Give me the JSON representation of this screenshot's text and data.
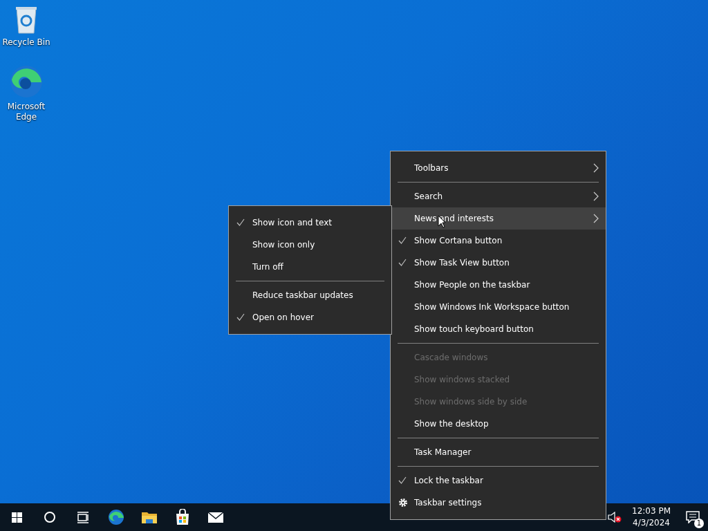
{
  "desktop_icons": [
    {
      "label": "Recycle Bin",
      "kind": "recycle"
    },
    {
      "label": "Microsoft Edge",
      "kind": "edge"
    }
  ],
  "context_menu": {
    "items": [
      {
        "kind": "item",
        "label": "Toolbars",
        "checked": false,
        "disabled": false,
        "submenu": true,
        "selected": false
      },
      {
        "kind": "separator"
      },
      {
        "kind": "item",
        "label": "Search",
        "checked": false,
        "disabled": false,
        "submenu": true,
        "selected": false
      },
      {
        "kind": "item",
        "label": "News and interests",
        "checked": false,
        "disabled": false,
        "submenu": true,
        "selected": true
      },
      {
        "kind": "item",
        "label": "Show Cortana button",
        "checked": true,
        "disabled": false,
        "submenu": false,
        "selected": false
      },
      {
        "kind": "item",
        "label": "Show Task View button",
        "checked": true,
        "disabled": false,
        "submenu": false,
        "selected": false
      },
      {
        "kind": "item",
        "label": "Show People on the taskbar",
        "checked": false,
        "disabled": false,
        "submenu": false,
        "selected": false
      },
      {
        "kind": "item",
        "label": "Show Windows Ink Workspace button",
        "checked": false,
        "disabled": false,
        "submenu": false,
        "selected": false
      },
      {
        "kind": "item",
        "label": "Show touch keyboard button",
        "checked": false,
        "disabled": false,
        "submenu": false,
        "selected": false
      },
      {
        "kind": "separator"
      },
      {
        "kind": "item",
        "label": "Cascade windows",
        "checked": false,
        "disabled": true,
        "submenu": false,
        "selected": false
      },
      {
        "kind": "item",
        "label": "Show windows stacked",
        "checked": false,
        "disabled": true,
        "submenu": false,
        "selected": false
      },
      {
        "kind": "item",
        "label": "Show windows side by side",
        "checked": false,
        "disabled": true,
        "submenu": false,
        "selected": false
      },
      {
        "kind": "item",
        "label": "Show the desktop",
        "checked": false,
        "disabled": false,
        "submenu": false,
        "selected": false
      },
      {
        "kind": "separator"
      },
      {
        "kind": "item",
        "label": "Task Manager",
        "checked": false,
        "disabled": false,
        "submenu": false,
        "selected": false
      },
      {
        "kind": "separator"
      },
      {
        "kind": "item",
        "label": "Lock the taskbar",
        "checked": true,
        "disabled": false,
        "submenu": false,
        "selected": false
      },
      {
        "kind": "gear-item",
        "label": "Taskbar settings",
        "checked": false,
        "disabled": false,
        "submenu": false,
        "selected": false
      }
    ]
  },
  "submenu": {
    "items": [
      {
        "kind": "item",
        "label": "Show icon and text",
        "checked": true,
        "disabled": false,
        "submenu": false,
        "selected": false
      },
      {
        "kind": "item",
        "label": "Show icon only",
        "checked": false,
        "disabled": false,
        "submenu": false,
        "selected": false
      },
      {
        "kind": "item",
        "label": "Turn off",
        "checked": false,
        "disabled": false,
        "submenu": false,
        "selected": false
      },
      {
        "kind": "separator"
      },
      {
        "kind": "item",
        "label": "Reduce taskbar updates",
        "checked": false,
        "disabled": false,
        "submenu": false,
        "selected": false
      },
      {
        "kind": "item",
        "label": "Open on hover",
        "checked": true,
        "disabled": false,
        "submenu": false,
        "selected": false
      }
    ]
  },
  "taskbar": {
    "buttons": [
      {
        "kind": "start"
      },
      {
        "kind": "cortana"
      },
      {
        "kind": "taskview"
      },
      {
        "kind": "edge"
      },
      {
        "kind": "explorer"
      },
      {
        "kind": "store"
      },
      {
        "kind": "mail"
      }
    ],
    "clock": {
      "time": "12:03 PM",
      "date": "4/3/2024"
    },
    "notifications": {
      "count": "1"
    }
  }
}
